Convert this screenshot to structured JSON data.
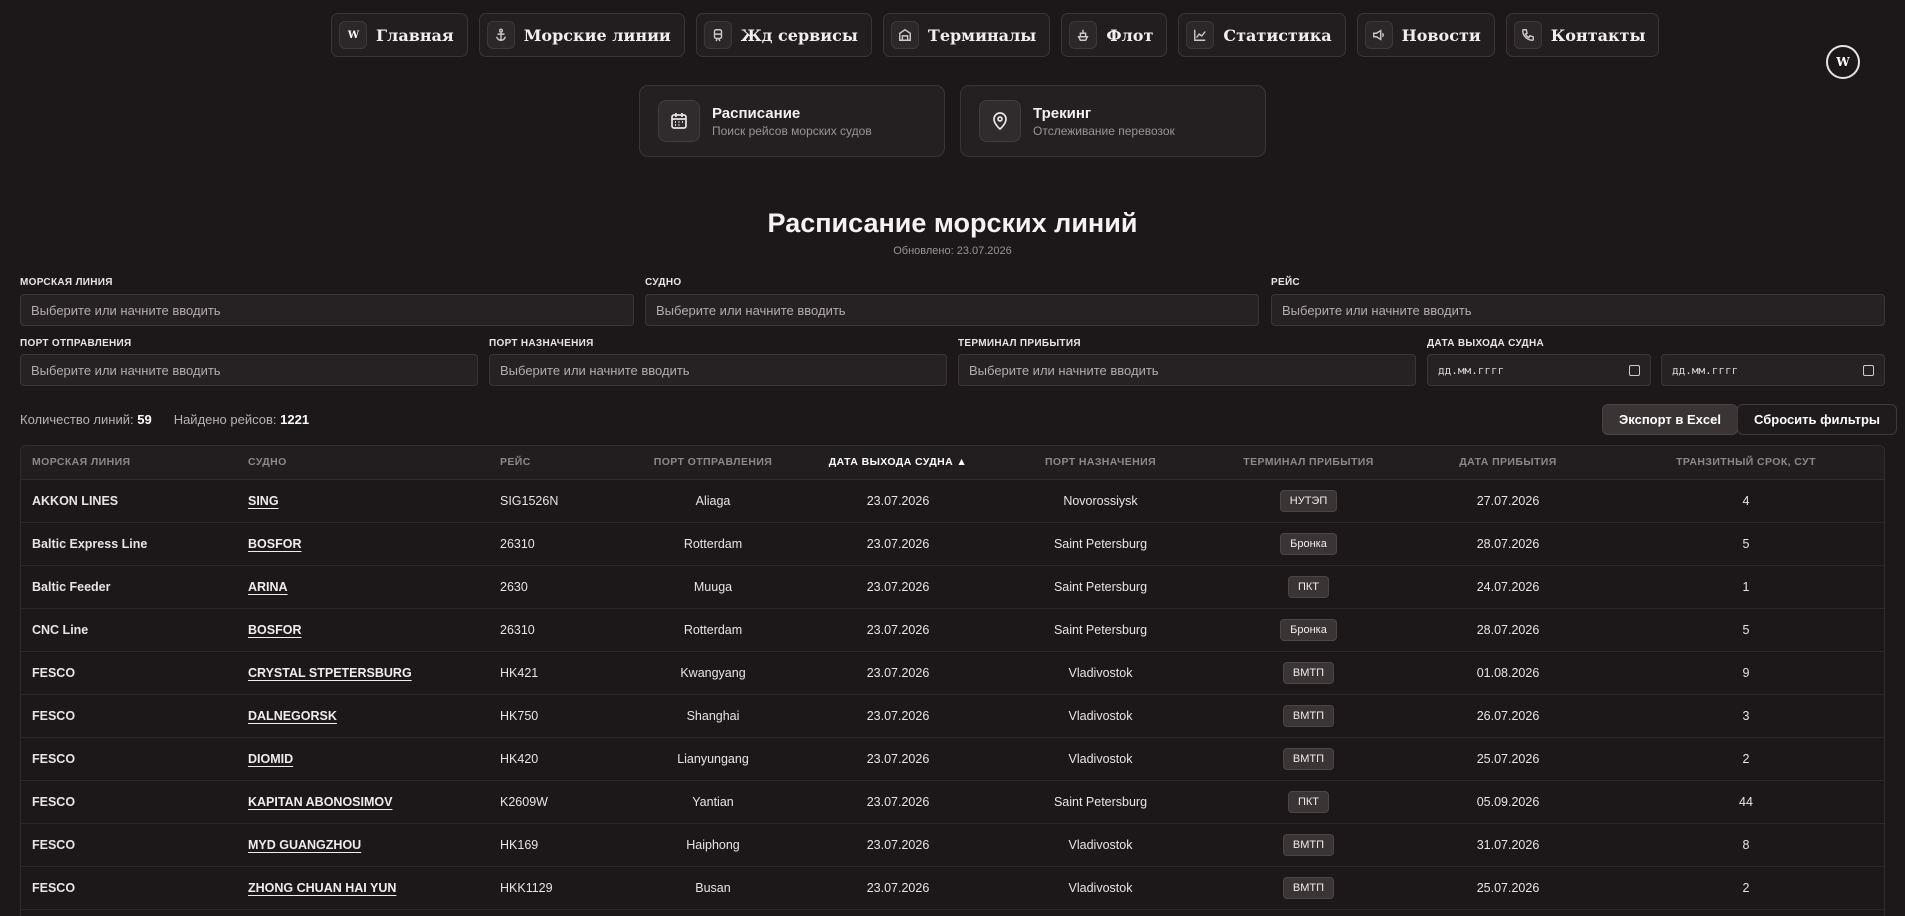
{
  "nav": {
    "items": [
      {
        "label": "Главная",
        "icon": "logo-icon"
      },
      {
        "label": "Морские линии",
        "icon": "anchor-icon"
      },
      {
        "label": "Жд сервисы",
        "icon": "train-icon"
      },
      {
        "label": "Терминалы",
        "icon": "warehouse-icon"
      },
      {
        "label": "Флот",
        "icon": "ship-icon"
      },
      {
        "label": "Статистика",
        "icon": "chart-icon"
      },
      {
        "label": "Новости",
        "icon": "megaphone-icon"
      },
      {
        "label": "Контакты",
        "icon": "phone-icon"
      }
    ]
  },
  "subnav": {
    "schedule": {
      "title": "Расписание",
      "desc": "Поиск рейсов морских судов",
      "icon": "calendar-icon"
    },
    "tracking": {
      "title": "Трекинг",
      "desc": "Отслеживание перевозок",
      "icon": "map-pin-icon"
    }
  },
  "page": {
    "title": "Расписание морских линий",
    "updated": "Обновлено: 23.07.2026"
  },
  "filters": {
    "sea_line": {
      "label": "МОРСКАЯ ЛИНИЯ",
      "placeholder": "Выберите или начните вводить"
    },
    "vessel": {
      "label": "СУДНО",
      "placeholder": "Выберите или начните вводить"
    },
    "voyage": {
      "label": "РЕЙС",
      "placeholder": "Выберите или начните вводить"
    },
    "departure_port": {
      "label": "ПОРТ ОТПРАВЛЕНИЯ",
      "placeholder": "Выберите или начните вводить"
    },
    "destination_port": {
      "label": "ПОРТ НАЗНАЧЕНИЯ",
      "placeholder": "Выберите или начните вводить"
    },
    "arrival_terminal": {
      "label": "ТЕРМИНАЛ ПРИБЫТИЯ",
      "placeholder": "Выберите или начните вводить"
    },
    "departure_date": {
      "label": "ДАТА ВЫХОДА СУДНА",
      "from_placeholder": "дд.мм.гггг",
      "to_placeholder": "дд.мм.гггг"
    }
  },
  "stats": {
    "lines_label": "Количество линий:",
    "lines_count": "59",
    "voyages_label": "Найдено рейсов:",
    "voyages_count": "1221"
  },
  "actions": {
    "export": "Экспорт в Excel",
    "reset": "Сбросить фильтры"
  },
  "table": {
    "columns": [
      "Морская линия",
      "Судно",
      "Рейс",
      "Порт отправления",
      "Дата выхода судна ▲",
      "Порт назначения",
      "Терминал прибытия",
      "Дата прибытия",
      "Транзитный срок, сут"
    ],
    "rows": [
      [
        "AKKON LINES",
        "SING",
        "SIG1526N",
        "Aliaga",
        "23.07.2026",
        "Novorossiysk",
        "НУТЭП",
        "27.07.2026",
        "4"
      ],
      [
        "Baltic Express Line",
        "BOSFOR",
        "26310",
        "Rotterdam",
        "23.07.2026",
        "Saint Petersburg",
        "Бронка",
        "28.07.2026",
        "5"
      ],
      [
        "Baltic Feeder",
        "ARINA",
        "2630",
        "Muuga",
        "23.07.2026",
        "Saint Petersburg",
        "ПКТ",
        "24.07.2026",
        "1"
      ],
      [
        "CNC Line",
        "BOSFOR",
        "26310",
        "Rotterdam",
        "23.07.2026",
        "Saint Petersburg",
        "Бронка",
        "28.07.2026",
        "5"
      ],
      [
        "FESCO",
        "CRYSTAL STPETERSBURG",
        "HK421",
        "Kwangyang",
        "23.07.2026",
        "Vladivostok",
        "ВМТП",
        "01.08.2026",
        "9"
      ],
      [
        "FESCO",
        "DALNEGORSK",
        "HK750",
        "Shanghai",
        "23.07.2026",
        "Vladivostok",
        "ВМТП",
        "26.07.2026",
        "3"
      ],
      [
        "FESCO",
        "DIOMID",
        "HK420",
        "Lianyungang",
        "23.07.2026",
        "Vladivostok",
        "ВМТП",
        "25.07.2026",
        "2"
      ],
      [
        "FESCO",
        "KAPITAN ABONOSIMOV",
        "K2609W",
        "Yantian",
        "23.07.2026",
        "Saint Petersburg",
        "ПКТ",
        "05.09.2026",
        "44"
      ],
      [
        "FESCO",
        "MYD GUANGZHOU",
        "HK169",
        "Haiphong",
        "23.07.2026",
        "Vladivostok",
        "ВМТП",
        "31.07.2026",
        "8"
      ],
      [
        "FESCO",
        "ZHONG CHUAN HAI YUN",
        "HKK1129",
        "Busan",
        "23.07.2026",
        "Vladivostok",
        "ВМТП",
        "25.07.2026",
        "2"
      ]
    ]
  },
  "colors": {
    "background": "#1c1819",
    "surface": "#262223",
    "border": "#3b3536",
    "text": "#e8e4e4",
    "muted": "#9a9394"
  }
}
